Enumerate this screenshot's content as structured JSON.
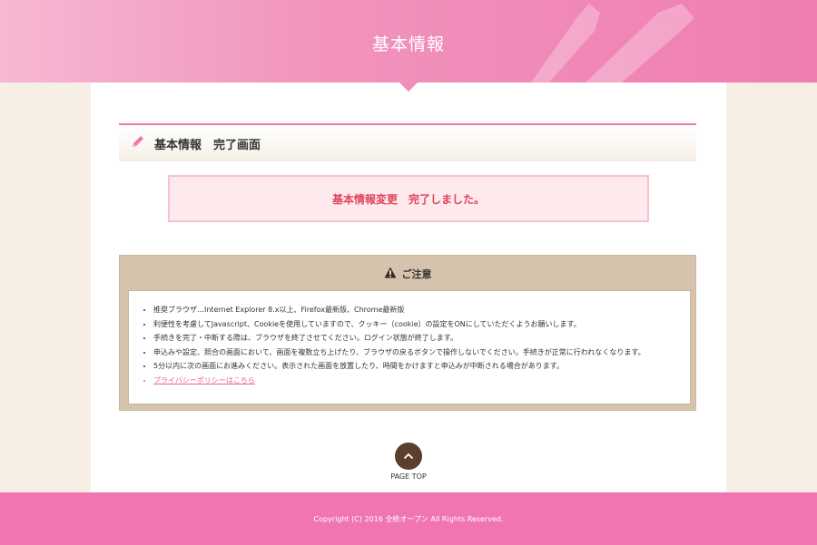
{
  "header": {
    "title": "基本情報"
  },
  "section": {
    "title": "基本情報　完了画面"
  },
  "message": {
    "text": "基本情報変更　完了しました。"
  },
  "notice": {
    "title": "ご注意",
    "items": [
      "推奨ブラウザ…Internet Explorer 8.x以上、Firefox最新版、Chrome最新版",
      "利便性を考慮してJavascript、Cookieを使用していますので、クッキー（cookie）の設定をONにしていただくようお願いします。",
      "手続きを完了・中断する際は、ブラウザを終了させてください。ログイン状態が終了します。",
      "申込みや設定、照合の画面において、画面を複数立ち上げたり、ブラウザの戻るボタンで操作しないでください。手続きが正常に行われなくなります。",
      "5分以内に次の画面にお進みください。表示された画面を放置したり、時間をかけますと申込みが中断される場合があります。"
    ],
    "privacy_link": "プライバシーポリシーはこちら"
  },
  "pagetop": {
    "label": "PAGE TOP"
  },
  "footer": {
    "copyright": "Copyright (C) 2016 全統オープン All Rights Reserved."
  },
  "colors": {
    "header_pink": "#f193bd",
    "footer_pink": "#f075b0",
    "message_red": "#e0445c",
    "notice_tan": "#d6c3ad",
    "pagetop_brown": "#5b3e2b"
  }
}
